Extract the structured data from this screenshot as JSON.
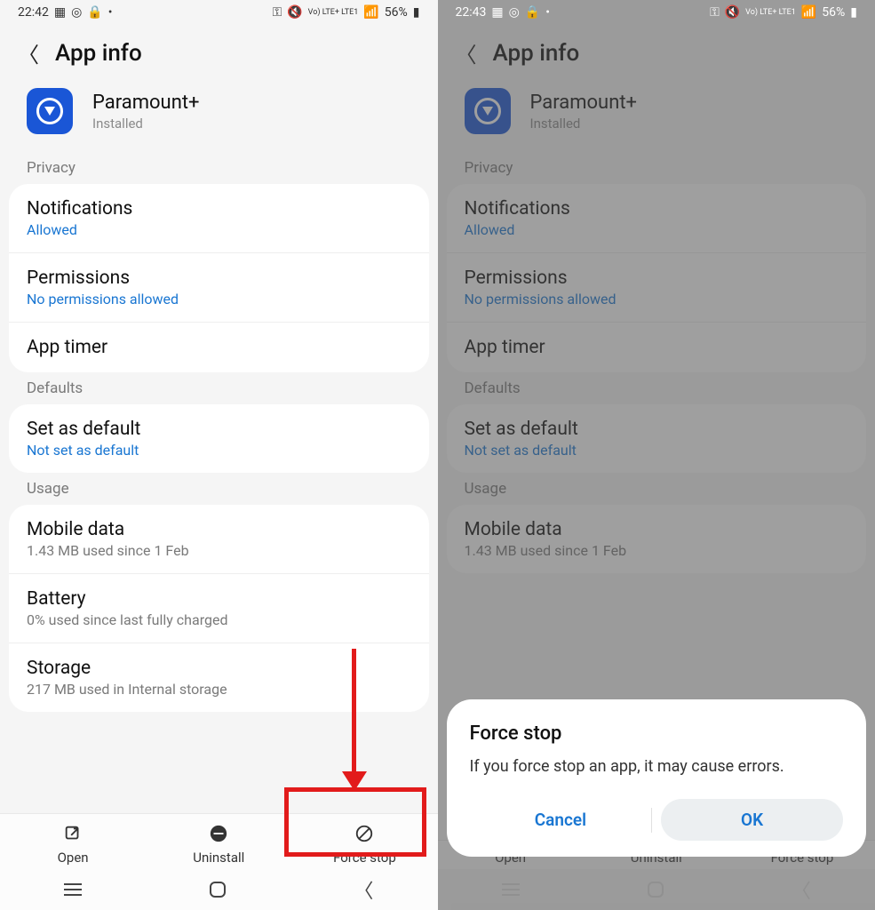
{
  "left": {
    "status": {
      "time": "22:42",
      "battery": "56%",
      "net": "Vo) LTE+ LTE1"
    },
    "header": "App info",
    "app": {
      "name": "Paramount+",
      "status": "Installed"
    },
    "sections": {
      "privacy": "Privacy",
      "defaults": "Defaults",
      "usage": "Usage"
    },
    "rows": {
      "notifications": {
        "title": "Notifications",
        "sub": "Allowed"
      },
      "permissions": {
        "title": "Permissions",
        "sub": "No permissions allowed"
      },
      "apptimer": {
        "title": "App timer"
      },
      "setdefault": {
        "title": "Set as default",
        "sub": "Not set as default"
      },
      "mobiledata": {
        "title": "Mobile data",
        "sub": "1.43 MB used since 1 Feb"
      },
      "battery": {
        "title": "Battery",
        "sub": "0% used since last fully charged"
      },
      "storage": {
        "title": "Storage",
        "sub": "217 MB used in Internal storage"
      }
    },
    "actions": {
      "open": "Open",
      "uninstall": "Uninstall",
      "forcestop": "Force stop"
    }
  },
  "right": {
    "status": {
      "time": "22:43",
      "battery": "56%",
      "net": "Vo) LTE+ LTE1"
    },
    "header": "App info",
    "app": {
      "name": "Paramount+",
      "status": "Installed"
    },
    "sections": {
      "privacy": "Privacy",
      "defaults": "Defaults",
      "usage": "Usage"
    },
    "rows": {
      "notifications": {
        "title": "Notifications",
        "sub": "Allowed"
      },
      "permissions": {
        "title": "Permissions",
        "sub": "No permissions allowed"
      },
      "apptimer": {
        "title": "App timer"
      },
      "setdefault": {
        "title": "Set as default",
        "sub": "Not set as default"
      },
      "mobiledata": {
        "title": "Mobile data",
        "sub": "1.43 MB used since 1 Feb"
      }
    },
    "actions": {
      "open": "Open",
      "uninstall": "Uninstall",
      "forcestop": "Force stop"
    },
    "dialog": {
      "title": "Force stop",
      "message": "If you force stop an app, it may cause errors.",
      "cancel": "Cancel",
      "ok": "OK"
    }
  }
}
